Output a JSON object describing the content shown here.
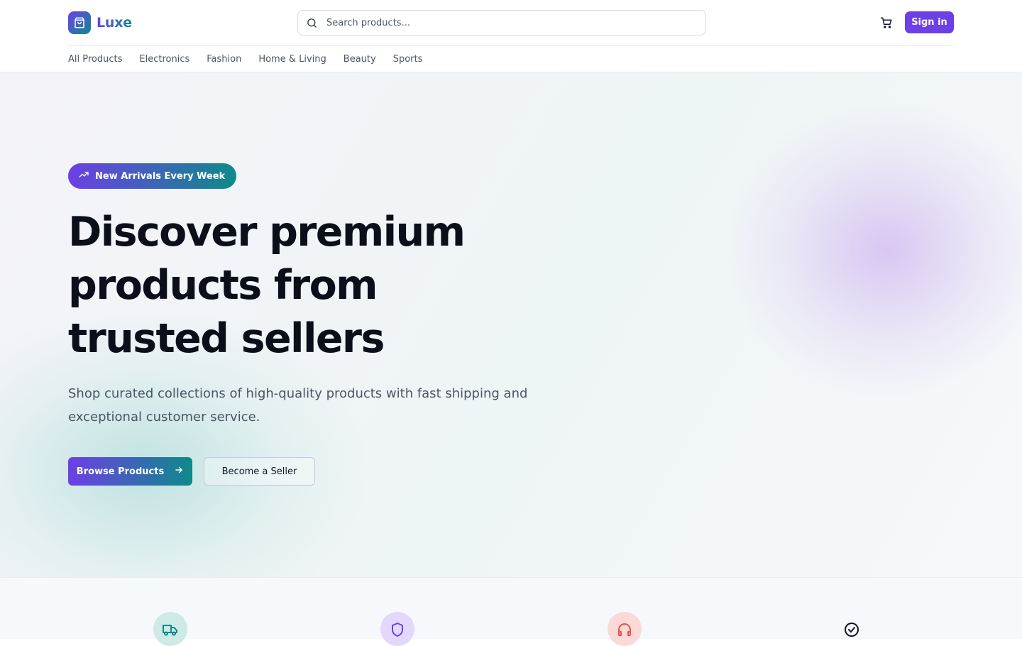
{
  "brand": {
    "name": "Luxe"
  },
  "search": {
    "placeholder": "Search products..."
  },
  "header": {
    "signin_label": "Sign in"
  },
  "categories": [
    "All Products",
    "Electronics",
    "Fashion",
    "Home & Living",
    "Beauty",
    "Sports"
  ],
  "hero": {
    "badge": "New Arrivals Every Week",
    "headline_lines": [
      "Discover premium",
      "products from",
      "trusted sellers"
    ],
    "subtitle": "Shop curated collections of high-quality products with fast shipping and exceptional customer service.",
    "primary_cta": "Browse Products",
    "secondary_cta": "Become a Seller"
  },
  "features": [
    {
      "icon": "truck-icon"
    },
    {
      "icon": "shield-icon"
    },
    {
      "icon": "headphones-icon"
    },
    {
      "icon": "check-circle-icon"
    }
  ],
  "colors": {
    "accent": "#6d3fe6",
    "teal": "#0e8a8a",
    "text": "#111827",
    "muted": "#4b5563"
  }
}
